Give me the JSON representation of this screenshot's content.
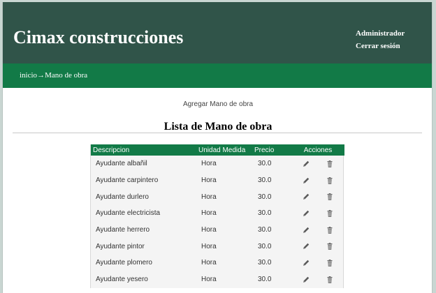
{
  "header": {
    "brand": "Cimax construcciones",
    "user_name": "Administrador",
    "logout": "Cerrar sesión"
  },
  "breadcrumb": {
    "home": "inicio",
    "separator": "→",
    "current": "Mano de obra"
  },
  "add_link": "Agregar Mano de obra",
  "list_title": "Lista de Mano de obra",
  "table": {
    "columns": [
      "Descripcion",
      "Unidad Medida",
      "Precio",
      "Acciones"
    ],
    "rows": [
      {
        "descripcion": "Ayudante albañil",
        "unidad": "Hora",
        "precio": "30.0"
      },
      {
        "descripcion": "Ayudante carpintero",
        "unidad": "Hora",
        "precio": "30.0"
      },
      {
        "descripcion": "Ayudante durlero",
        "unidad": "Hora",
        "precio": "30.0"
      },
      {
        "descripcion": "Ayudante electricista",
        "unidad": "Hora",
        "precio": "30.0"
      },
      {
        "descripcion": "Ayudante herrero",
        "unidad": "Hora",
        "precio": "30.0"
      },
      {
        "descripcion": "Ayudante pintor",
        "unidad": "Hora",
        "precio": "30.0"
      },
      {
        "descripcion": "Ayudante plomero",
        "unidad": "Hora",
        "precio": "30.0"
      },
      {
        "descripcion": "Ayudante yesero",
        "unidad": "Hora",
        "precio": "30.0"
      }
    ],
    "action_icons": [
      "pencil-icon",
      "trash-icon"
    ]
  },
  "colors": {
    "header_bg": "#305449",
    "navbar_bg": "#127a47",
    "table_header_bg": "#127a47"
  }
}
